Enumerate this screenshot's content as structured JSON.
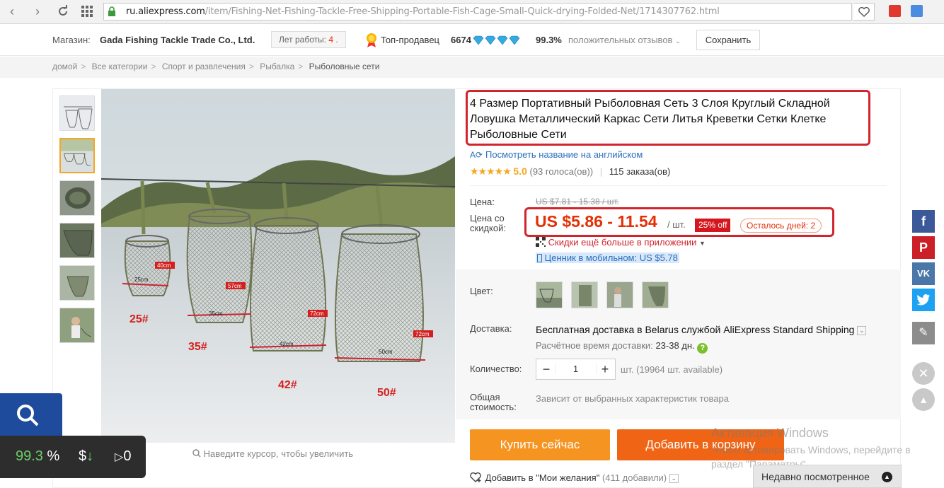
{
  "browser": {
    "url_host": "ru.aliexpress.com",
    "url_path": "/item/Fishing-Net-Fishing-Tackle-Free-Shipping-Portable-Fish-Cage-Small-Quick-drying-Folded-Net/1714307762.html"
  },
  "store": {
    "label": "Магазин:",
    "name": "Gada Fishing Tackle Trade Co., Ltd.",
    "years_label": "Лет работы:",
    "years_value": "4 .",
    "top_seller_label": "Топ-продавец",
    "seller_score": "6674",
    "positive_pct": "99.3%",
    "positive_label": "положительных отзывов",
    "save_button": "Сохранить"
  },
  "breadcrumb": {
    "items": [
      "домой",
      "Все категории",
      "Спорт и развлечения",
      "Рыбалка"
    ],
    "current": "Рыболовные сети"
  },
  "gallery": {
    "zoom_hint": "Наведите курсор, чтобы увеличить",
    "image_labels": [
      "25#",
      "35#",
      "42#",
      "50#"
    ],
    "dimension_labels": [
      "25cm",
      "40cm",
      "35cm",
      "57cm",
      "42cm",
      "72cm",
      "50cm",
      "72cm"
    ]
  },
  "product": {
    "title": "4 Размер Портативный Рыболовная Сеть 3 Слоя Круглый Складной Ловушка Металлический Каркас Сети Литья Креветки Сетки Клетке Рыболовные Сети",
    "english_link": "Посмотреть название на английском",
    "rating_score": "5.0",
    "votes": "(93 голоса(ов))",
    "orders": "115 заказа(ов)",
    "price_label": "Цена:",
    "old_price": "US $7.81 - 15.38 / шт.",
    "discount_label": "Цена со скидкой:",
    "price": "US $5.86 - 11.54",
    "unit": "/ шт.",
    "discount_badge": "25% off",
    "days_left": "Осталось дней: 2",
    "app_discount": "Скидки ещё больше в приложении",
    "mobile_price": "Ценник в мобильном: US $5.78",
    "color_label": "Цвет:",
    "shipping_label": "Доставка:",
    "shipping_text": "Бесплатная доставка в Belarus службой AliExpress Standard Shipping",
    "eta_label": "Расчётное время доставки:",
    "eta_value": "23-38 дн.",
    "qty_label": "Количество:",
    "qty_value": "1",
    "availability": "шт. (19964 шт. available)",
    "total_label": "Общая стоимость:",
    "total_value": "Зависит от выбранных характеристик товара",
    "buy_now": "Купить сейчас",
    "add_to_cart": "Добавить в корзину",
    "wishlist": "Добавить в \"Мои желания\"",
    "wishlist_count": "(411 добавили)"
  },
  "windows_watermark": {
    "title": "Активация Windows",
    "line1": "Чтобы активировать Windows, перейдите в",
    "line2": "раздел \"Параметры\"."
  },
  "recently_viewed": "Недавно посмотренное",
  "overlay": {
    "percent": "99.3",
    "percent_sign": "%",
    "dollar": "$",
    "arrow": "↓",
    "play_count": "0"
  },
  "colors": {
    "accent_red": "#e62e04",
    "highlight_border": "#d0252d",
    "buy_orange": "#f69421",
    "cart_orange": "#f06515",
    "link_blue": "#2a6ebb"
  }
}
